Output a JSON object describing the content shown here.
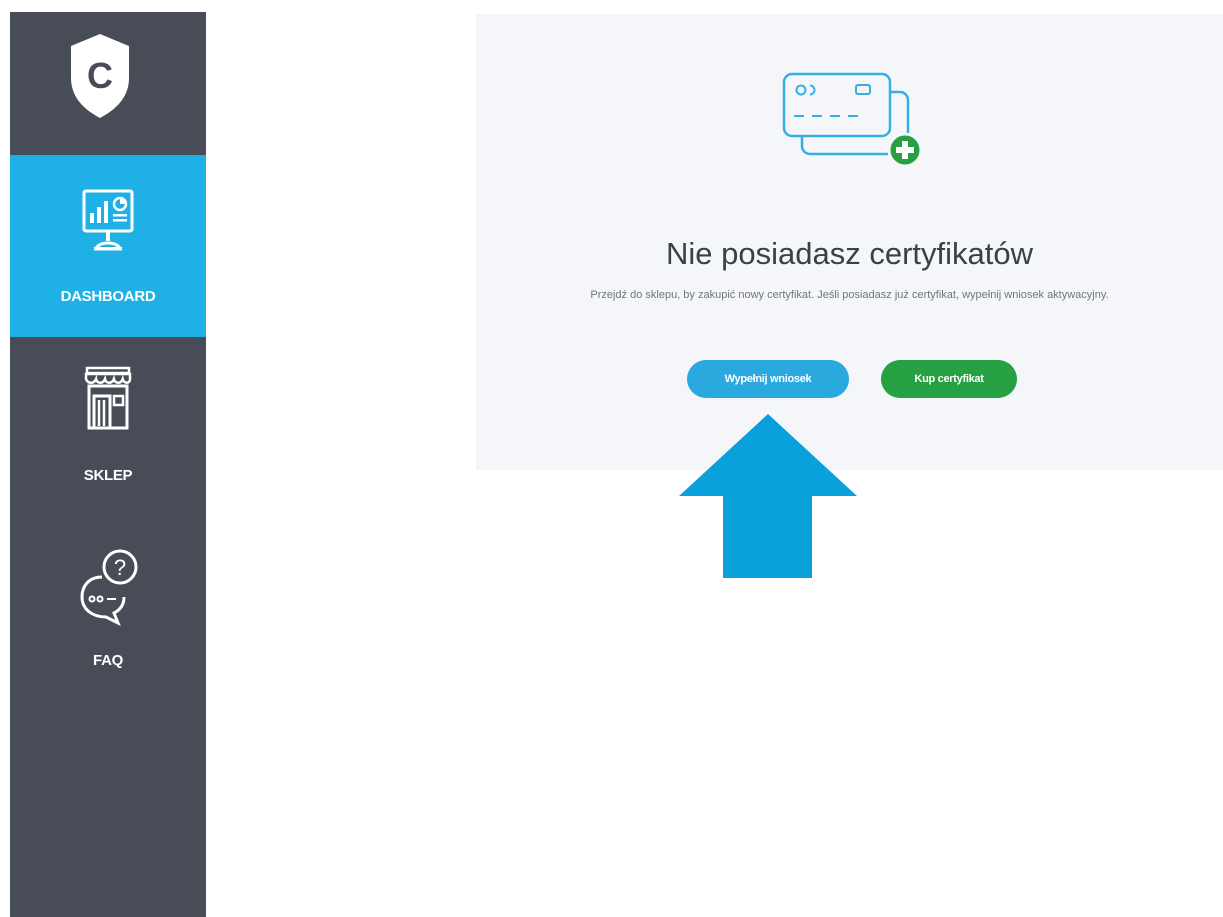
{
  "sidebar": {
    "logo_letter": "C",
    "logo_icon": "shield-c-logo-icon",
    "items": [
      {
        "label": "DASHBOARD",
        "icon": "dashboard-monitor-icon",
        "active": true
      },
      {
        "label": "SKLEP",
        "icon": "shop-icon",
        "active": false
      },
      {
        "label": "FAQ",
        "icon": "faq-chat-question-icon",
        "active": false
      }
    ]
  },
  "main": {
    "empty_state_icon": "credit-card-add-icon",
    "title": "Nie posiadasz certyfikatów",
    "description": "Przejdź do sklepu, by zakupić nowy certyfikat. Jeśli posiadasz już certyfikat, wypełnij wniosek aktywacyjny.",
    "buttons": {
      "fill_request": "Wypełnij wniosek",
      "buy_certificate": "Kup certyfikat"
    }
  },
  "annotation": {
    "icon": "arrow-up-icon"
  },
  "colors": {
    "sidebar_bg": "#474c56",
    "active_item_bg": "#1fb0e6",
    "card_bg": "#f5f6f9",
    "primary_button": "#2aa9df",
    "success_button": "#27a043",
    "arrow": "#0aa0dc"
  }
}
